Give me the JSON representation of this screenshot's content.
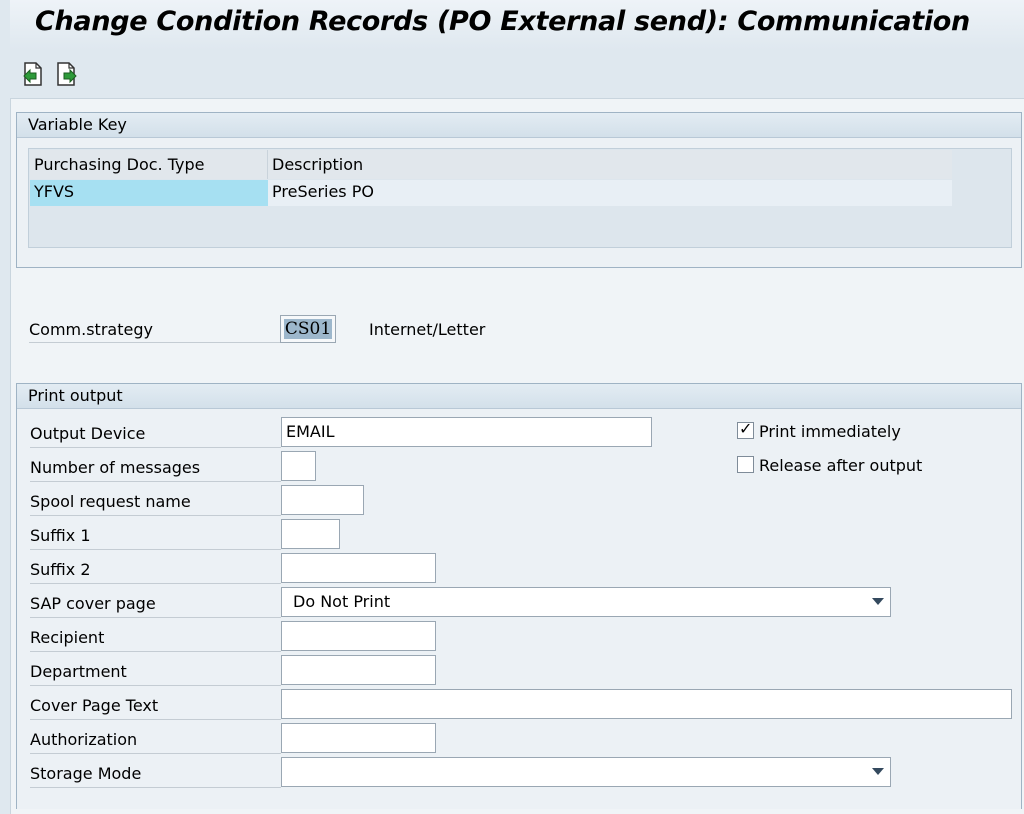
{
  "window": {
    "title": "Change Condition Records (PO External send): Communication"
  },
  "toolbar": {
    "buttons": [
      {
        "icon": "previous-document-icon"
      },
      {
        "icon": "next-document-icon"
      }
    ]
  },
  "variable_key": {
    "title": "Variable Key",
    "columns": [
      "Purchasing Doc. Type",
      "Description"
    ],
    "rows": [
      {
        "doc_type": "YFVS",
        "description": "PreSeries PO"
      }
    ]
  },
  "comm_strategy": {
    "label": "Comm.strategy",
    "value": "CS01",
    "description": "Internet/Letter"
  },
  "print_output": {
    "title": "Print output",
    "output_device": {
      "label": "Output Device",
      "value": "EMAIL"
    },
    "number_of_messages": {
      "label": "Number of messages",
      "value": ""
    },
    "spool_request_name": {
      "label": "Spool request name",
      "value": ""
    },
    "suffix1": {
      "label": "Suffix 1",
      "value": ""
    },
    "suffix2": {
      "label": "Suffix 2",
      "value": ""
    },
    "sap_cover_page": {
      "label": "SAP cover page",
      "value": "Do Not Print"
    },
    "recipient": {
      "label": "Recipient",
      "value": ""
    },
    "department": {
      "label": "Department",
      "value": ""
    },
    "cover_page_text": {
      "label": "Cover Page Text",
      "value": ""
    },
    "authorization": {
      "label": "Authorization",
      "value": ""
    },
    "storage_mode": {
      "label": "Storage Mode",
      "value": ""
    },
    "print_immediately": {
      "label": "Print immediately",
      "checked": true
    },
    "release_after_output": {
      "label": "Release after output",
      "checked": false
    }
  }
}
